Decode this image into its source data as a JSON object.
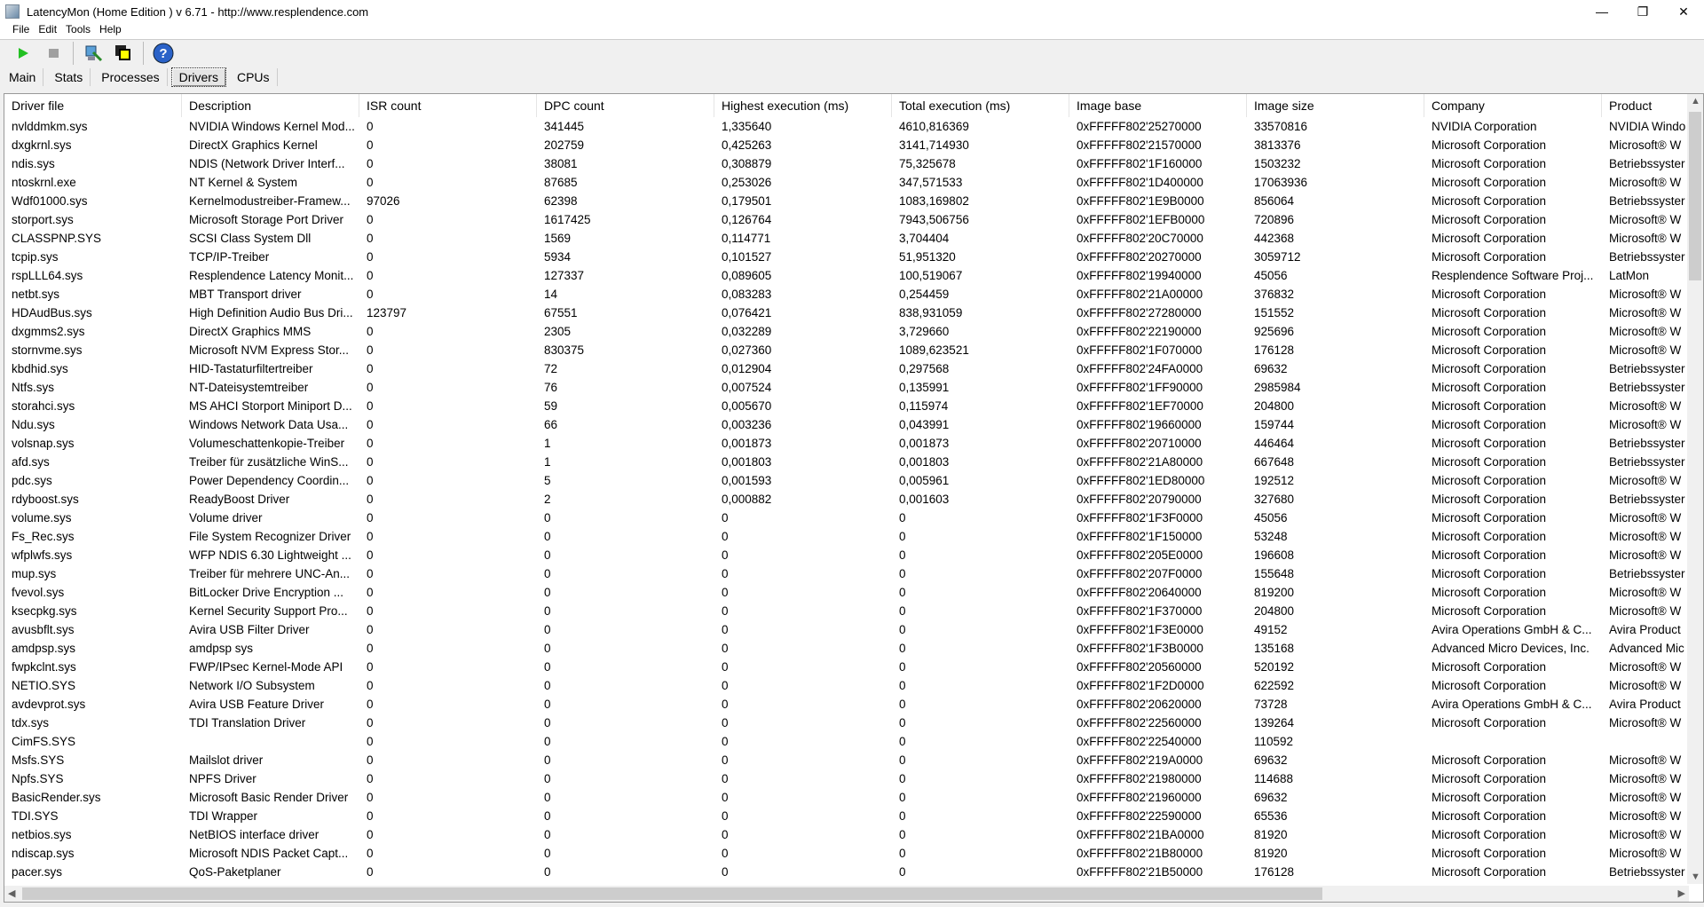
{
  "window": {
    "title": "LatencyMon  (Home Edition )  v 6.71 - http://www.resplendence.com",
    "minimize": "—",
    "maximize": "❐",
    "close": "✕"
  },
  "menu": [
    "File",
    "Edit",
    "Tools",
    "Help"
  ],
  "toolbar": {
    "icons": [
      "play-icon",
      "stop-icon",
      "analyze-icon",
      "windows-icon",
      "help-icon"
    ]
  },
  "tabs": [
    {
      "label": "Main"
    },
    {
      "label": "Stats"
    },
    {
      "label": "Processes"
    },
    {
      "label": "Drivers",
      "active": true
    },
    {
      "label": "CPUs"
    }
  ],
  "table": {
    "columns": [
      "Driver file",
      "Description",
      "ISR count",
      "DPC count",
      "Highest execution (ms)",
      "Total execution (ms)",
      "Image base",
      "Image size",
      "Company",
      "Product"
    ],
    "rows": [
      [
        "nvlddmkm.sys",
        "NVIDIA Windows Kernel Mod...",
        "0",
        "341445",
        "1,335640",
        "4610,816369",
        "0xFFFFF802'25270000",
        "33570816",
        "NVIDIA Corporation",
        "NVIDIA Windo"
      ],
      [
        "dxgkrnl.sys",
        "DirectX Graphics Kernel",
        "0",
        "202759",
        "0,425263",
        "3141,714930",
        "0xFFFFF802'21570000",
        "3813376",
        "Microsoft Corporation",
        "Microsoft® W"
      ],
      [
        "ndis.sys",
        "NDIS (Network Driver Interf...",
        "0",
        "38081",
        "0,308879",
        "75,325678",
        "0xFFFFF802'1F160000",
        "1503232",
        "Microsoft Corporation",
        "Betriebssyster"
      ],
      [
        "ntoskrnl.exe",
        "NT Kernel & System",
        "0",
        "87685",
        "0,253026",
        "347,571533",
        "0xFFFFF802'1D400000",
        "17063936",
        "Microsoft Corporation",
        "Microsoft® W"
      ],
      [
        "Wdf01000.sys",
        "Kernelmodustreiber-Framew...",
        "97026",
        "62398",
        "0,179501",
        "1083,169802",
        "0xFFFFF802'1E9B0000",
        "856064",
        "Microsoft Corporation",
        "Betriebssyster"
      ],
      [
        "storport.sys",
        "Microsoft Storage Port Driver",
        "0",
        "1617425",
        "0,126764",
        "7943,506756",
        "0xFFFFF802'1EFB0000",
        "720896",
        "Microsoft Corporation",
        "Microsoft® W"
      ],
      [
        "CLASSPNP.SYS",
        "SCSI Class System Dll",
        "0",
        "1569",
        "0,114771",
        "3,704404",
        "0xFFFFF802'20C70000",
        "442368",
        "Microsoft Corporation",
        "Microsoft® W"
      ],
      [
        "tcpip.sys",
        "TCP/IP-Treiber",
        "0",
        "5934",
        "0,101527",
        "51,951320",
        "0xFFFFF802'20270000",
        "3059712",
        "Microsoft Corporation",
        "Betriebssyster"
      ],
      [
        "rspLLL64.sys",
        "Resplendence Latency Monit...",
        "0",
        "127337",
        "0,089605",
        "100,519067",
        "0xFFFFF802'19940000",
        "45056",
        "Resplendence Software Proj...",
        "LatMon"
      ],
      [
        "netbt.sys",
        "MBT Transport driver",
        "0",
        "14",
        "0,083283",
        "0,254459",
        "0xFFFFF802'21A00000",
        "376832",
        "Microsoft Corporation",
        "Microsoft® W"
      ],
      [
        "HDAudBus.sys",
        "High Definition Audio Bus Dri...",
        "123797",
        "67551",
        "0,076421",
        "838,931059",
        "0xFFFFF802'27280000",
        "151552",
        "Microsoft Corporation",
        "Microsoft® W"
      ],
      [
        "dxgmms2.sys",
        "DirectX Graphics MMS",
        "0",
        "2305",
        "0,032289",
        "3,729660",
        "0xFFFFF802'22190000",
        "925696",
        "Microsoft Corporation",
        "Microsoft® W"
      ],
      [
        "stornvme.sys",
        "Microsoft NVM Express Stor...",
        "0",
        "830375",
        "0,027360",
        "1089,623521",
        "0xFFFFF802'1F070000",
        "176128",
        "Microsoft Corporation",
        "Microsoft® W"
      ],
      [
        "kbdhid.sys",
        "HID-Tastaturfiltertreiber",
        "0",
        "72",
        "0,012904",
        "0,297568",
        "0xFFFFF802'24FA0000",
        "69632",
        "Microsoft Corporation",
        "Betriebssyster"
      ],
      [
        "Ntfs.sys",
        "NT-Dateisystemtreiber",
        "0",
        "76",
        "0,007524",
        "0,135991",
        "0xFFFFF802'1FF90000",
        "2985984",
        "Microsoft Corporation",
        "Betriebssyster"
      ],
      [
        "storahci.sys",
        "MS AHCI Storport Miniport D...",
        "0",
        "59",
        "0,005670",
        "0,115974",
        "0xFFFFF802'1EF70000",
        "204800",
        "Microsoft Corporation",
        "Microsoft® W"
      ],
      [
        "Ndu.sys",
        "Windows Network Data Usa...",
        "0",
        "66",
        "0,003236",
        "0,043991",
        "0xFFFFF802'19660000",
        "159744",
        "Microsoft Corporation",
        "Microsoft® W"
      ],
      [
        "volsnap.sys",
        "Volumeschattenkopie-Treiber",
        "0",
        "1",
        "0,001873",
        "0,001873",
        "0xFFFFF802'20710000",
        "446464",
        "Microsoft Corporation",
        "Betriebssyster"
      ],
      [
        "afd.sys",
        "Treiber für zusätzliche WinS...",
        "0",
        "1",
        "0,001803",
        "0,001803",
        "0xFFFFF802'21A80000",
        "667648",
        "Microsoft Corporation",
        "Betriebssyster"
      ],
      [
        "pdc.sys",
        "Power Dependency Coordin...",
        "0",
        "5",
        "0,001593",
        "0,005961",
        "0xFFFFF802'1ED80000",
        "192512",
        "Microsoft Corporation",
        "Microsoft® W"
      ],
      [
        "rdyboost.sys",
        "ReadyBoost Driver",
        "0",
        "2",
        "0,000882",
        "0,001603",
        "0xFFFFF802'20790000",
        "327680",
        "Microsoft Corporation",
        "Betriebssyster"
      ],
      [
        "volume.sys",
        "Volume driver",
        "0",
        "0",
        "0",
        "0",
        "0xFFFFF802'1F3F0000",
        "45056",
        "Microsoft Corporation",
        "Microsoft® W"
      ],
      [
        "Fs_Rec.sys",
        "File System Recognizer Driver",
        "0",
        "0",
        "0",
        "0",
        "0xFFFFF802'1F150000",
        "53248",
        "Microsoft Corporation",
        "Microsoft® W"
      ],
      [
        "wfplwfs.sys",
        "WFP NDIS 6.30 Lightweight ...",
        "0",
        "0",
        "0",
        "0",
        "0xFFFFF802'205E0000",
        "196608",
        "Microsoft Corporation",
        "Microsoft® W"
      ],
      [
        "mup.sys",
        "Treiber für mehrere UNC-An...",
        "0",
        "0",
        "0",
        "0",
        "0xFFFFF802'207F0000",
        "155648",
        "Microsoft Corporation",
        "Betriebssyster"
      ],
      [
        "fvevol.sys",
        "BitLocker Drive Encryption ...",
        "0",
        "0",
        "0",
        "0",
        "0xFFFFF802'20640000",
        "819200",
        "Microsoft Corporation",
        "Microsoft® W"
      ],
      [
        "ksecpkg.sys",
        "Kernel Security Support Pro...",
        "0",
        "0",
        "0",
        "0",
        "0xFFFFF802'1F370000",
        "204800",
        "Microsoft Corporation",
        "Microsoft® W"
      ],
      [
        "avusbflt.sys",
        "Avira USB Filter Driver",
        "0",
        "0",
        "0",
        "0",
        "0xFFFFF802'1F3E0000",
        "49152",
        "Avira Operations GmbH & C...",
        "Avira Product"
      ],
      [
        "amdpsp.sys",
        "amdpsp sys",
        "0",
        "0",
        "0",
        "0",
        "0xFFFFF802'1F3B0000",
        "135168",
        "Advanced Micro Devices, Inc.",
        "Advanced Mic"
      ],
      [
        "fwpkclnt.sys",
        "FWP/IPsec Kernel-Mode API",
        "0",
        "0",
        "0",
        "0",
        "0xFFFFF802'20560000",
        "520192",
        "Microsoft Corporation",
        "Microsoft® W"
      ],
      [
        "NETIO.SYS",
        "Network I/O Subsystem",
        "0",
        "0",
        "0",
        "0",
        "0xFFFFF802'1F2D0000",
        "622592",
        "Microsoft Corporation",
        "Microsoft® W"
      ],
      [
        "avdevprot.sys",
        "Avira USB Feature Driver",
        "0",
        "0",
        "0",
        "0",
        "0xFFFFF802'20620000",
        "73728",
        "Avira Operations GmbH & C...",
        "Avira Product"
      ],
      [
        "tdx.sys",
        "TDI Translation Driver",
        "0",
        "0",
        "0",
        "0",
        "0xFFFFF802'22560000",
        "139264",
        "Microsoft Corporation",
        "Microsoft® W"
      ],
      [
        "CimFS.SYS",
        "",
        "0",
        "0",
        "0",
        "0",
        "0xFFFFF802'22540000",
        "110592",
        "",
        ""
      ],
      [
        "Msfs.SYS",
        "Mailslot driver",
        "0",
        "0",
        "0",
        "0",
        "0xFFFFF802'219A0000",
        "69632",
        "Microsoft Corporation",
        "Microsoft® W"
      ],
      [
        "Npfs.SYS",
        "NPFS Driver",
        "0",
        "0",
        "0",
        "0",
        "0xFFFFF802'21980000",
        "114688",
        "Microsoft Corporation",
        "Microsoft® W"
      ],
      [
        "BasicRender.sys",
        "Microsoft Basic Render Driver",
        "0",
        "0",
        "0",
        "0",
        "0xFFFFF802'21960000",
        "69632",
        "Microsoft Corporation",
        "Microsoft® W"
      ],
      [
        "TDI.SYS",
        "TDI Wrapper",
        "0",
        "0",
        "0",
        "0",
        "0xFFFFF802'22590000",
        "65536",
        "Microsoft Corporation",
        "Microsoft® W"
      ],
      [
        "netbios.sys",
        "NetBIOS interface driver",
        "0",
        "0",
        "0",
        "0",
        "0xFFFFF802'21BA0000",
        "81920",
        "Microsoft Corporation",
        "Microsoft® W"
      ],
      [
        "ndiscap.sys",
        "Microsoft NDIS Packet Capt...",
        "0",
        "0",
        "0",
        "0",
        "0xFFFFF802'21B80000",
        "81920",
        "Microsoft Corporation",
        "Microsoft® W"
      ],
      [
        "pacer.sys",
        "QoS-Paketplaner",
        "0",
        "0",
        "0",
        "0",
        "0xFFFFF802'21B50000",
        "176128",
        "Microsoft Corporation",
        "Betriebssyster"
      ]
    ]
  }
}
